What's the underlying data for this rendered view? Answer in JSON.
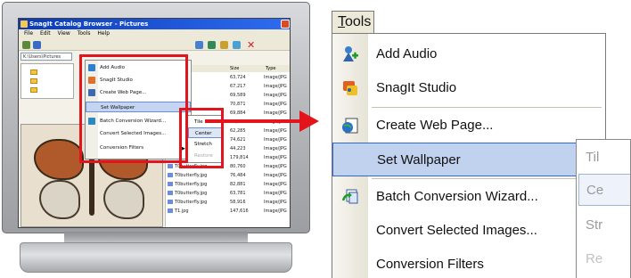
{
  "mini_window": {
    "title": "SnagIt Catalog Browser - Pictures",
    "menus": [
      "File",
      "Edit",
      "View",
      "Tools",
      "Help"
    ],
    "address": "K:\\Users\\Pictures",
    "list_headers": [
      "",
      "Size",
      "Type"
    ],
    "rows": [
      {
        "name": "",
        "size": "63,724",
        "type": "Image/JPG"
      },
      {
        "name": "",
        "size": "67,217",
        "type": "Image/JPG"
      },
      {
        "name": "",
        "size": "69,589",
        "type": "Image/JPG"
      },
      {
        "name": "",
        "size": "70,871",
        "type": "Image/JPG"
      },
      {
        "name": "",
        "size": "69,884",
        "type": "Image/JPG"
      },
      {
        "name": "",
        "size": "60,583",
        "type": "Image/JPG"
      },
      {
        "name": "",
        "size": "62,285",
        "type": "Image/JPG"
      },
      {
        "name": "pic026.jpg",
        "size": "74,621",
        "type": "Image/JPG"
      },
      {
        "name": "pic027.jpg",
        "size": "44,223",
        "type": "Image/JPG"
      },
      {
        "name": "T0.jpg",
        "size": "179,814",
        "type": "Image/JPG"
      },
      {
        "name": "T0butterfly.jpg",
        "size": "80,760",
        "type": "Image/JPG"
      },
      {
        "name": "T0butterfly.jpg",
        "size": "76,484",
        "type": "Image/JPG"
      },
      {
        "name": "T0butterfly.jpg",
        "size": "82,881",
        "type": "Image/JPG"
      },
      {
        "name": "T0butterfly.jpg",
        "size": "63,781",
        "type": "Image/JPG"
      },
      {
        "name": "T0butterfly.jpg",
        "size": "58,916",
        "type": "Image/JPG"
      },
      {
        "name": "T1.jpg",
        "size": "147,616",
        "type": "Image/JPG"
      }
    ],
    "menu_items": [
      "Add Audio",
      "SnagIt Studio",
      "Create Web Page...",
      "Set Wallpaper",
      "Batch Conversion Wizard...",
      "Convert Selected Images...",
      "Conversion Filters"
    ],
    "submenu_items": [
      "Tile",
      "Center",
      "Stretch",
      "Restore"
    ]
  },
  "zoom_menu": {
    "title_first": "T",
    "title_rest": "ools",
    "items": [
      {
        "label": "Add Audio",
        "icon": "add-audio-icon",
        "highlighted": false
      },
      {
        "label": "SnagIt Studio",
        "icon": "snagit-studio-icon",
        "highlighted": false
      },
      {
        "label": "Create Web Page...",
        "icon": "create-web-page-icon",
        "highlighted": false
      },
      {
        "label": "Set Wallpaper",
        "icon": "",
        "highlighted": true
      },
      {
        "label": "Batch Conversion Wizard...",
        "icon": "batch-conversion-icon",
        "highlighted": false
      },
      {
        "label": "Convert Selected Images...",
        "icon": "",
        "highlighted": false
      },
      {
        "label": "Conversion Filters",
        "icon": "",
        "highlighted": false
      }
    ],
    "submenu": [
      "Til",
      "Ce",
      "Str",
      "Re"
    ]
  },
  "colors": {
    "highlight": "#c1d2ee",
    "highlight_border": "#316ac5",
    "callout_red": "#e3141b"
  }
}
